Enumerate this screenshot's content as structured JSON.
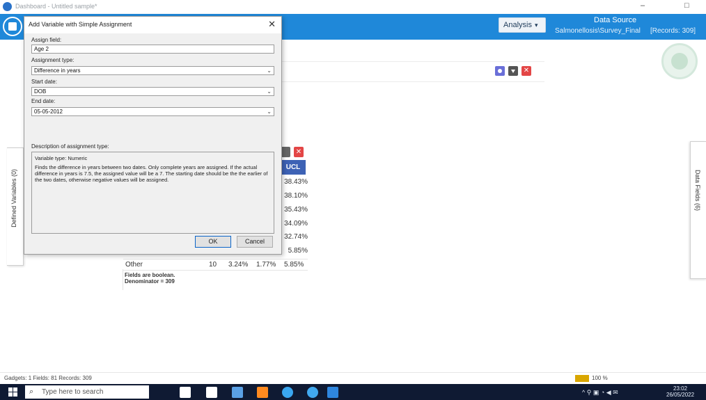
{
  "window": {
    "title": "Dashboard - Untitled sample*",
    "controls": [
      "–",
      "□"
    ]
  },
  "appbar": {
    "analysis_label": "Analysis",
    "data_source_title": "Data Source",
    "data_source_path": "Salmonellosis\\Survey_Final",
    "records": "[Records: 309]"
  },
  "side_tabs": {
    "left": "Defined Variables (0)",
    "right": "Data Fields (6)"
  },
  "dialog": {
    "title": "Add Variable with Simple Assignment",
    "close": "✕",
    "assign_field_label": "Assign field:",
    "assign_field_value": "Age 2",
    "assignment_type_label": "Assignment type:",
    "assignment_type_value": "Difference in years",
    "start_date_label": "Start date:",
    "start_date_value": "DOB",
    "end_date_label": "End date:",
    "end_date_value": "05-05-2012",
    "description_label": "Description of assignment type:",
    "variable_type": "Variable type:  Numeric",
    "description_text": "Finds the difference in years between two dates. Only complete years are assigned. If the actual difference in years is 7.5, the assigned value will be a 7. The starting date should be the the earlier of the two dates, otherwise negative values will be assigned.",
    "ok_label": "OK",
    "cancel_label": "Cancel"
  },
  "table": {
    "header": "UCL",
    "ucl_values": [
      "38.43%",
      "38.10%",
      "35.43%",
      "34.09%",
      "32.74%",
      "5.85%"
    ],
    "other_row": {
      "label": "Other",
      "count": "10",
      "pct": "3.24%",
      "lcl": "1.77%",
      "ucl": "5.85%"
    },
    "footnote": [
      "Fields are boolean.",
      "Denominator = 309"
    ]
  },
  "statusbar": {
    "text": "Gadgets: 1  Fields: 81  Records: 309",
    "zoom": "100 %"
  },
  "taskbar": {
    "search_placeholder": "Type here to search",
    "clock_time": "23:02",
    "clock_date": "26/05/2022",
    "apps": [
      {
        "name": "penguin-app-icon",
        "color": "#ffffff"
      },
      {
        "name": "audio-app-icon",
        "color": "#ffffff"
      },
      {
        "name": "mail-app-icon",
        "color": "#5aa1e6"
      },
      {
        "name": "fire-app-icon",
        "color": "#ff8a1f"
      },
      {
        "name": "blue-circle-app-icon",
        "color": "#3aa7f0"
      },
      {
        "name": "gear-app-icon",
        "color": "#41a9ef"
      },
      {
        "name": "active-app-icon",
        "color": "#2e86de"
      }
    ]
  },
  "colors": {
    "appbar": "#1f88d9",
    "table_header": "#3d62b5",
    "close_red": "#e34646",
    "taskbar": "#0f1a33"
  }
}
